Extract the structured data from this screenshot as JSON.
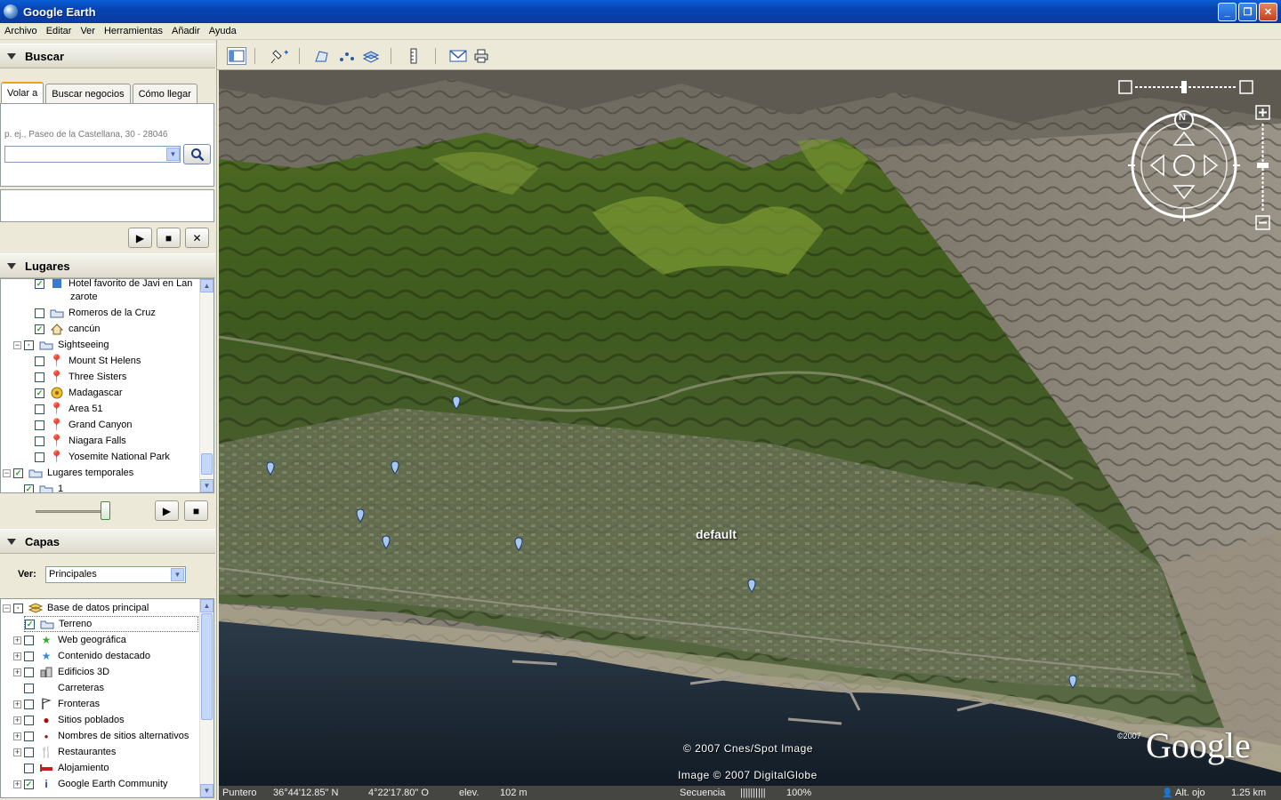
{
  "window": {
    "title": "Google Earth"
  },
  "menu": [
    "Archivo",
    "Editar",
    "Ver",
    "Herramientas",
    "Añadir",
    "Ayuda"
  ],
  "search": {
    "header": "Buscar",
    "tabs": [
      "Volar a",
      "Buscar negocios",
      "Cómo llegar"
    ],
    "hint": "p. ej., Paseo de la Castellana, 30 - 28046",
    "value": ""
  },
  "places": {
    "header": "Lugares",
    "items": [
      {
        "label": "Hotel favorito de Javi en Lan",
        "label2": "zarote",
        "checked": true,
        "icon": "pin-icon"
      },
      {
        "label": "Romeros de la Cruz",
        "checked": false,
        "icon": "folder-icon"
      },
      {
        "label": "cancún",
        "checked": true,
        "icon": "house-icon"
      },
      {
        "label": "Sightseeing",
        "checked": false,
        "icon": "folder-icon"
      },
      {
        "label": "Mount St Helens",
        "checked": false,
        "icon": "pushpin-icon"
      },
      {
        "label": "Three Sisters",
        "checked": false,
        "icon": "pushpin-icon"
      },
      {
        "label": "Madagascar",
        "checked": true,
        "icon": "globe-icon"
      },
      {
        "label": "Area 51",
        "checked": false,
        "icon": "pushpin-icon"
      },
      {
        "label": "Grand Canyon",
        "checked": false,
        "icon": "pushpin-icon"
      },
      {
        "label": "Niagara Falls",
        "checked": false,
        "icon": "pushpin-icon"
      },
      {
        "label": "Yosemite National Park",
        "checked": false,
        "icon": "pushpin-icon"
      },
      {
        "label": "Lugares temporales",
        "checked": true,
        "icon": "folder-icon"
      },
      {
        "label": "1",
        "checked": true,
        "icon": "folder-icon"
      }
    ]
  },
  "layers": {
    "header": "Capas",
    "view_label": "Ver:",
    "view_value": "Principales",
    "items": [
      {
        "label": "Base de datos principal",
        "checked": true
      },
      {
        "label": "Terreno",
        "checked": true
      },
      {
        "label": "Web geográfica",
        "checked": false
      },
      {
        "label": "Contenido destacado",
        "checked": false
      },
      {
        "label": "Edificios 3D",
        "checked": false
      },
      {
        "label": "Carreteras",
        "checked": false
      },
      {
        "label": "Fronteras",
        "checked": false
      },
      {
        "label": "Sitios poblados",
        "checked": false
      },
      {
        "label": "Nombres de sitios alternativos",
        "checked": false
      },
      {
        "label": "Restaurantes",
        "checked": false
      },
      {
        "label": "Alojamiento",
        "checked": false
      },
      {
        "label": "Google Earth Community",
        "checked": true
      }
    ]
  },
  "map": {
    "label": "default",
    "copyright1": "© 2007 Cnes/Spot Image",
    "copyright2": "Image © 2007 DigitalGlobe",
    "logo_year": "©2007",
    "logo": "Google",
    "compass_n": "N"
  },
  "status": {
    "pointer_label": "Puntero",
    "lat": "36°44'12.85\" N",
    "lon": "4°22'17.80\" O",
    "elev_label": "elev.",
    "elev": "102 m",
    "stream_label": "Secuencia",
    "stream_bar": "||||||||||",
    "stream_pct": "100%",
    "eye_label": "Alt. ojo",
    "eye": "1.25 km"
  }
}
